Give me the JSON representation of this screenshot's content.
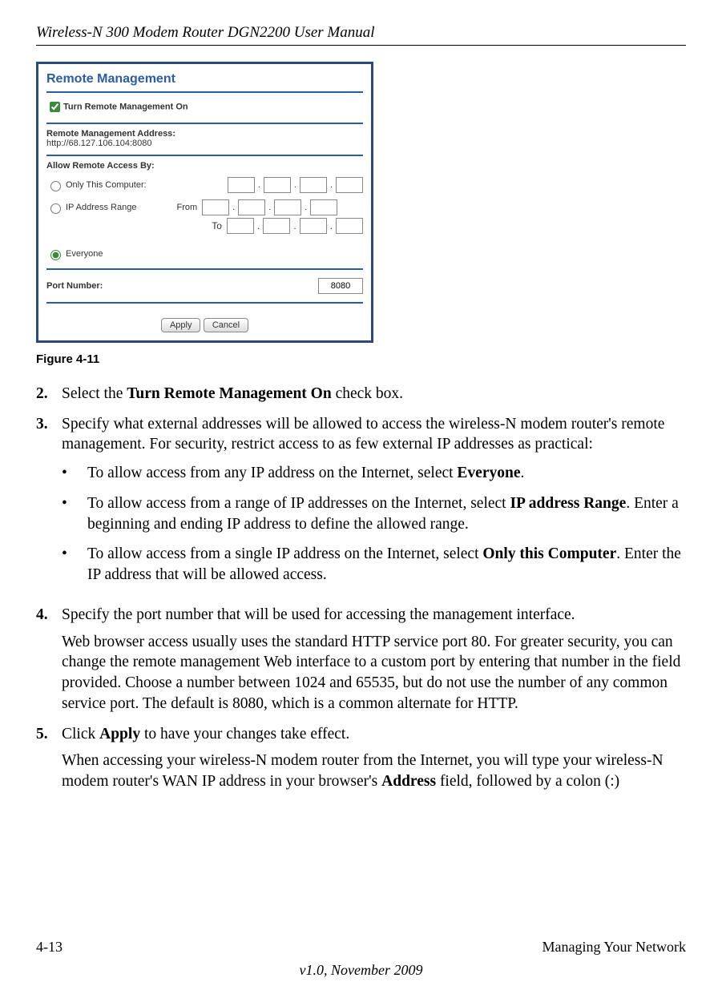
{
  "header_title": "Wireless-N 300 Modem Router DGN2200 User Manual",
  "screenshot": {
    "panel_title": "Remote Management",
    "checkbox_label": "Turn Remote Management On",
    "addr_label": "Remote Management Address:",
    "addr_value": "http://68.127.106.104:8080",
    "allow_label": "Allow Remote Access By:",
    "radio_only_this": "Only This Computer:",
    "radio_ip_range": "IP Address Range",
    "from_label": "From",
    "to_label": "To",
    "radio_everyone": "Everyone",
    "port_label": "Port Number:",
    "port_value": "8080",
    "apply_btn": "Apply",
    "cancel_btn": "Cancel"
  },
  "figure_label": "Figure 4-11",
  "steps": {
    "n2": "2.",
    "t2_a": "Select the ",
    "t2_b": "Turn Remote Management On",
    "t2_c": " check box.",
    "n3": "3.",
    "t3": "Specify what external addresses will be allowed to access the wireless-N modem router's remote management. For security, restrict access to as few external IP addresses as practical:",
    "b1_a": "To allow access from any IP address on the Internet, select ",
    "b1_b": "Everyone",
    "b1_c": ".",
    "b2_a": "To allow access from a range of IP addresses on the Internet, select ",
    "b2_b": "IP address Range",
    "b2_c": ". Enter a beginning and ending IP address to define the allowed range.",
    "b3_a": "To allow access from a single IP address on the Internet, select ",
    "b3_b": "Only this Computer",
    "b3_c": ". Enter the IP address that will be allowed access.",
    "n4": "4.",
    "t4": "Specify the port number that will be used for accessing the management interface.",
    "t4p": "Web browser access usually uses the standard HTTP service port 80. For greater security, you can change the remote management Web interface to a custom port by entering that number in the field provided. Choose a number between 1024 and 65535, but do not use the number of any common service port. The default is 8080, which is a common alternate for HTTP.",
    "n5": "5.",
    "t5_a": "Click ",
    "t5_b": "Apply",
    "t5_c": " to have your changes take effect.",
    "t5p_a": "When accessing your wireless-N modem router from the Internet, you will type your wireless-N modem router's WAN IP address in your browser's ",
    "t5p_b": "Address",
    "t5p_c": " field, followed by a colon (:)"
  },
  "footer": {
    "page_num": "4-13",
    "right": "Managing Your Network",
    "version": "v1.0, November 2009"
  }
}
